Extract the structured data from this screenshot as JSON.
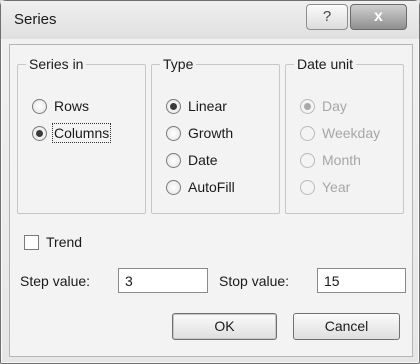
{
  "window": {
    "title": "Series",
    "help_label": "?",
    "close_label": "x"
  },
  "series_in": {
    "title": "Series in",
    "options": [
      {
        "label": "Rows",
        "checked": false
      },
      {
        "label": "Columns",
        "checked": true
      }
    ]
  },
  "type": {
    "title": "Type",
    "options": [
      {
        "label": "Linear",
        "checked": true
      },
      {
        "label": "Growth",
        "checked": false
      },
      {
        "label": "Date",
        "checked": false
      },
      {
        "label": "AutoFill",
        "checked": false
      }
    ]
  },
  "date_unit": {
    "title": "Date unit",
    "options": [
      {
        "label": "Day",
        "checked": true
      },
      {
        "label": "Weekday",
        "checked": false
      },
      {
        "label": "Month",
        "checked": false
      },
      {
        "label": "Year",
        "checked": false
      }
    ]
  },
  "trend": {
    "label": "Trend",
    "checked": false
  },
  "step": {
    "label": "Step value:",
    "value": "3"
  },
  "stop": {
    "label": "Stop value:",
    "value": "15"
  },
  "buttons": {
    "ok": "OK",
    "cancel": "Cancel"
  }
}
